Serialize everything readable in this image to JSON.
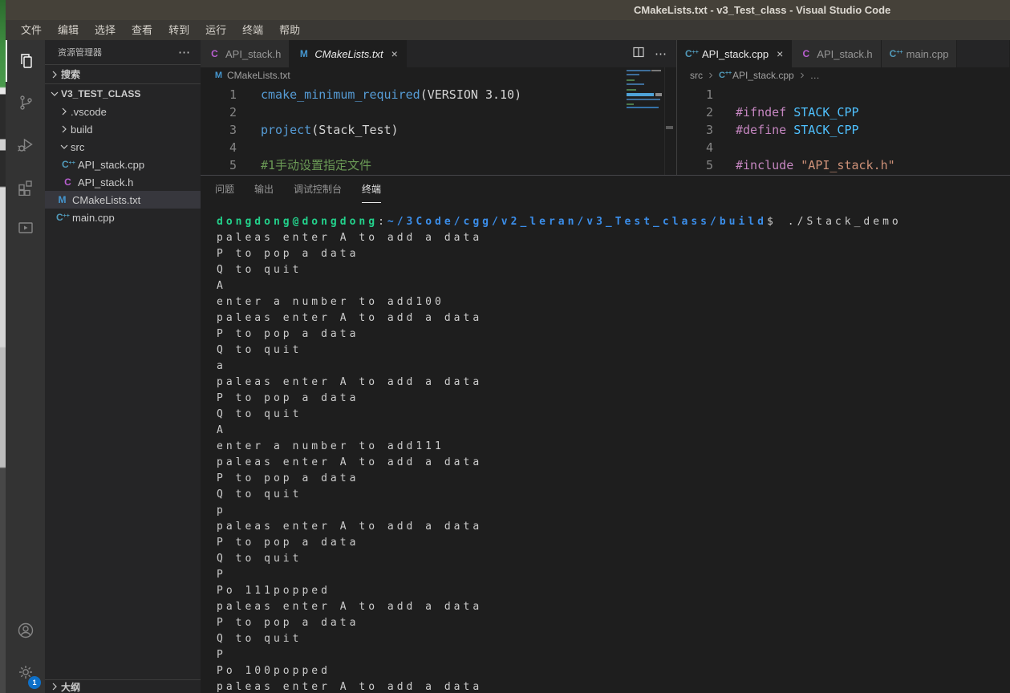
{
  "window": {
    "title": "CMakeLists.txt - v3_Test_class - Visual Studio Code"
  },
  "menu_bar": {
    "items": [
      "文件",
      "编辑",
      "选择",
      "查看",
      "转到",
      "运行",
      "终端",
      "帮助"
    ]
  },
  "activity_bar": {
    "settings_badge": "1"
  },
  "sidebar": {
    "header": {
      "title": "资源管理器",
      "more_glyph": "⋯"
    },
    "search_section": "搜索",
    "root_section": "V3_TEST_CLASS",
    "outline_section": "大纲",
    "tree": {
      "items": [
        {
          "label": ".vscode"
        },
        {
          "label": "build"
        },
        {
          "label": "src"
        },
        {
          "label": "API_stack.cpp",
          "icon_letter": "C"
        },
        {
          "label": "API_stack.h",
          "icon_letter": "C"
        },
        {
          "label": "CMakeLists.txt",
          "icon_letter": "M"
        },
        {
          "label": "main.cpp",
          "icon_letter": "C"
        }
      ]
    }
  },
  "editor_left": {
    "tabs": [
      {
        "label": "API_stack.h",
        "icon_letter": "C"
      },
      {
        "label": "CMakeLists.txt",
        "icon_letter": "M",
        "close": "×"
      }
    ],
    "actions": {
      "more_glyph": "⋯"
    },
    "breadcrumb": {
      "file": "CMakeLists.txt",
      "icon_letter": "M"
    },
    "lines": [
      {
        "num": "1",
        "tokens": [
          {
            "t": "cmake_minimum_required"
          },
          {
            "t": "(VERSION 3.10)"
          }
        ]
      },
      {
        "num": "2"
      },
      {
        "num": "3",
        "tokens": [
          {
            "t": "project"
          },
          {
            "t": "(Stack_Test)"
          }
        ]
      },
      {
        "num": "4"
      },
      {
        "num": "5",
        "tokens": [
          {
            "t": "#1手动设置指定文件"
          }
        ]
      }
    ]
  },
  "editor_right": {
    "tabs": [
      {
        "label": "API_stack.cpp",
        "icon_letter": "C",
        "close": "×"
      },
      {
        "label": "API_stack.h",
        "icon_letter": "C"
      },
      {
        "label": "main.cpp",
        "icon_letter": "C"
      }
    ],
    "breadcrumb": {
      "folder": "src",
      "file": "API_stack.cpp",
      "more": "…",
      "icon_letter": "C"
    },
    "lines": [
      {
        "num": "1"
      },
      {
        "num": "2",
        "tokens": [
          {
            "t": "#ifndef "
          },
          {
            "t": "STACK_CPP"
          }
        ]
      },
      {
        "num": "3",
        "tokens": [
          {
            "t": "#define "
          },
          {
            "t": "STACK_CPP"
          }
        ]
      },
      {
        "num": "4"
      },
      {
        "num": "5",
        "tokens": [
          {
            "t": "#include "
          },
          {
            "t": "\"API_stack.h\""
          }
        ]
      }
    ]
  },
  "panel": {
    "tabs": [
      {
        "label": "问题"
      },
      {
        "label": "输出"
      },
      {
        "label": "调试控制台"
      },
      {
        "label": "终端"
      }
    ],
    "terminal": {
      "prompt": {
        "user": "dongdong@dongdong",
        "colon": ":",
        "path": "~/3Code/cgg/v2_leran/v3_Test_class/build",
        "dollar": "$",
        "command": "./Stack_demo"
      },
      "lines": [
        "paleas enter A to add a data",
        "P to pop a data",
        "Q to quit",
        "A",
        "enter a number to add100",
        "paleas enter A to add a data",
        "P to pop a data",
        "Q to quit",
        "a",
        "paleas enter A to add a data",
        "P to pop a data",
        "Q to quit",
        "A",
        "enter a number to add111",
        "paleas enter A to add a data",
        "P to pop a data",
        "Q to quit",
        "p",
        "paleas enter A to add a data",
        "P to pop a data",
        "Q to quit",
        "P",
        "Po 111popped",
        "paleas enter A to add a data",
        "P to pop a data",
        "Q to quit",
        "P",
        "Po 100popped",
        "paleas enter A to add a data"
      ]
    }
  },
  "colors": {
    "accent_badge": "#0e70c8",
    "terminal_green": "#23d18b",
    "terminal_blue": "#3b8eea",
    "syntax_function_blue": "#569cd6",
    "syntax_comment_green": "#6a9955",
    "syntax_preprocessor_pink": "#c586c0",
    "syntax_macro_blue": "#4fc1ff",
    "syntax_string_orange": "#ce9178",
    "icon_cpp_blue": "#519aba",
    "icon_header_purple": "#b95fd1",
    "icon_cmake_blue": "#4596cf",
    "selection_row": "#37373d"
  }
}
